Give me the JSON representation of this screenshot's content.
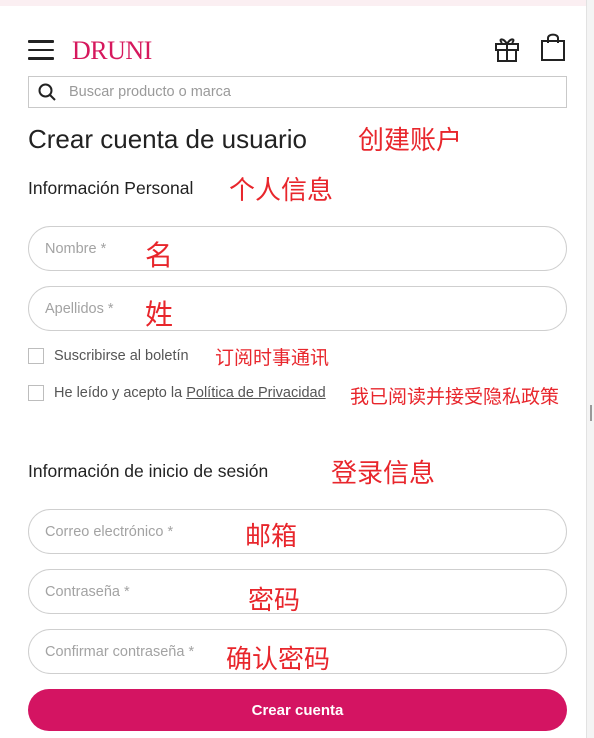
{
  "header": {
    "logo": "DRUNI",
    "menu_icon": "hamburger-menu-icon",
    "gift_icon": "gift-icon",
    "bag_icon": "shopping-bag-icon"
  },
  "search": {
    "placeholder": "Buscar producto o marca",
    "icon": "search-icon"
  },
  "page": {
    "title": "Crear cuenta de usuario",
    "title_annotation": "创建账户"
  },
  "personal": {
    "heading": "Información Personal",
    "heading_annotation": "个人信息",
    "name_placeholder": "Nombre *",
    "name_annotation": "名",
    "surname_placeholder": "Apellidos *",
    "surname_annotation": "姓",
    "newsletter_label": "Suscribirse al boletín",
    "newsletter_annotation": "订阅时事通讯",
    "privacy_label_prefix": "He leído y acepto la ",
    "privacy_link": "Política de Privacidad",
    "privacy_annotation": "我已阅读并接受隐私政策"
  },
  "login": {
    "heading": "Información de inicio de sesión",
    "heading_annotation": "登录信息",
    "email_placeholder": "Correo electrónico *",
    "email_annotation": "邮箱",
    "password_placeholder": "Contraseña *",
    "password_annotation": "密码",
    "confirm_placeholder": "Confirmar contraseña *",
    "confirm_annotation": "确认密码"
  },
  "submit_label": "Crear cuenta",
  "colors": {
    "brand": "#d6185d",
    "button": "#d41462",
    "annotation": "#e8262c"
  }
}
